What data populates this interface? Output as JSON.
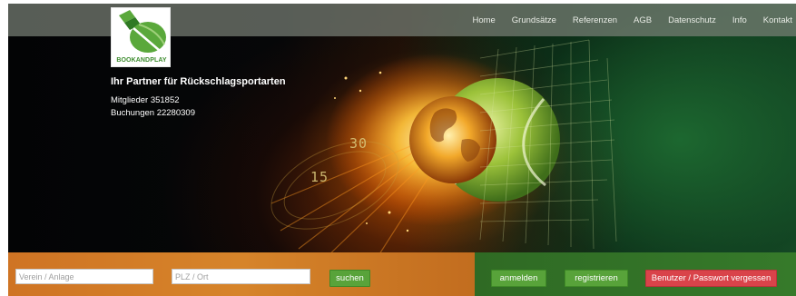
{
  "nav": {
    "items": [
      "Home",
      "Grundsätze",
      "Referenzen",
      "AGB",
      "Datenschutz",
      "Info",
      "Kontakt"
    ]
  },
  "logo": {
    "text": "BOOKANDPLAY",
    "colors": {
      "green": "#5aa83b",
      "dark_green": "#2f7a24",
      "light_green": "#9fd07a"
    }
  },
  "hero": {
    "tagline": "Ihr Partner für Rückschlagsportarten",
    "members": "Mitglieder 351852",
    "bookings": "Buchungen 22280309",
    "score_a": "30",
    "score_b": "15"
  },
  "search": {
    "club_placeholder": "Verein / Anlage",
    "city_placeholder": "PLZ / Ort",
    "search_label": "suchen"
  },
  "account": {
    "login_label": "anmelden",
    "register_label": "registrieren",
    "forgot_label": "Benutzer / Passwort vergessen"
  },
  "colors": {
    "button_green": "#58a33a",
    "button_red": "#d9434a",
    "bar_orange": "#d27d24",
    "bar_green": "#347527",
    "nav_bg": "#78807a"
  }
}
